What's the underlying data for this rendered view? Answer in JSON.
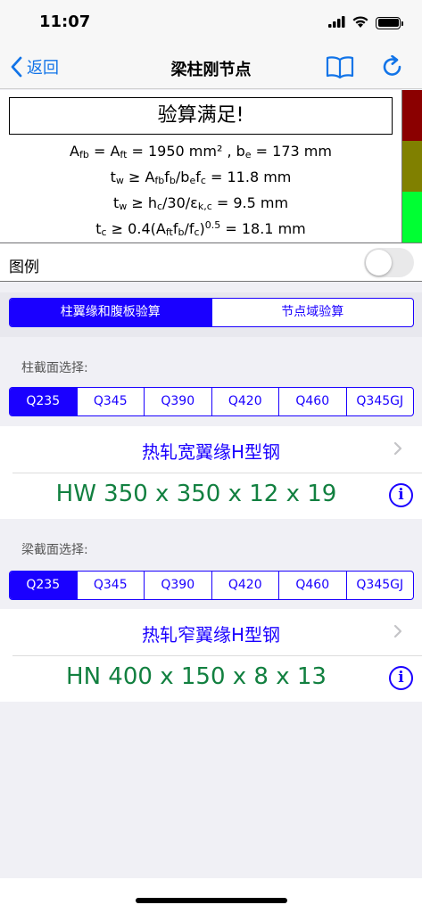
{
  "status_bar": {
    "time": "11:07"
  },
  "nav": {
    "back_label": "返回",
    "title": "梁柱刚节点",
    "book_icon": "book-icon",
    "refresh_icon": "refresh-icon"
  },
  "result": {
    "status": "验算满足!",
    "formulas": {
      "f1": {
        "a": "A",
        "a_sub": "fb",
        "b": " = A",
        "b_sub": "ft",
        "c": " = 1950 mm² , b",
        "c_sub": "e",
        "d": " = 173 mm"
      },
      "f2": {
        "a": "t",
        "a_sub": "w",
        "b": " ≥ A",
        "b_sub": "fb",
        "c": "f",
        "c_sub": "b",
        "d": "/b",
        "d_sub": "e",
        "e": "f",
        "e_sub": "c",
        "f": " = 11.8 mm"
      },
      "f3": {
        "a": "t",
        "a_sub": "w",
        "b": " ≥ h",
        "b_sub": "c",
        "c": "/30/ε",
        "c_sub": "k,c",
        "d": " = 9.5 mm"
      },
      "f4": {
        "a": "t",
        "a_sub": "c",
        "b": " ≥ 0.4(A",
        "b_sub": "ft",
        "c": "f",
        "c_sub": "b",
        "d": "/f",
        "d_sub": "c",
        "e": ")",
        "e_sup": "0.5",
        "f": " = 18.1 mm"
      }
    },
    "level_colors": [
      "#8b0000",
      "#808000",
      "#00ff33"
    ]
  },
  "legend": {
    "label": "图例",
    "toggle_on": false
  },
  "mode_tabs": {
    "items": [
      "柱翼缘和腹板验算",
      "节点域验算"
    ],
    "selected": 0
  },
  "column": {
    "section_label": "柱截面选择:",
    "grades": [
      "Q235",
      "Q345",
      "Q390",
      "Q420",
      "Q460",
      "Q345GJ"
    ],
    "selected_grade": "Q235",
    "type": "热轧宽翼缘H型钢",
    "size": "HW 350 x 350 x 12 x 19"
  },
  "beam": {
    "section_label": "梁截面选择:",
    "grades": [
      "Q235",
      "Q345",
      "Q390",
      "Q420",
      "Q460",
      "Q345GJ"
    ],
    "selected_grade": "Q235",
    "type": "热轧窄翼缘H型钢",
    "size": "HN 400 x 150 x 8 x 13"
  },
  "colors": {
    "accent": "#1a00ff",
    "ios_blue": "#1274e8",
    "size_green": "#128040"
  }
}
